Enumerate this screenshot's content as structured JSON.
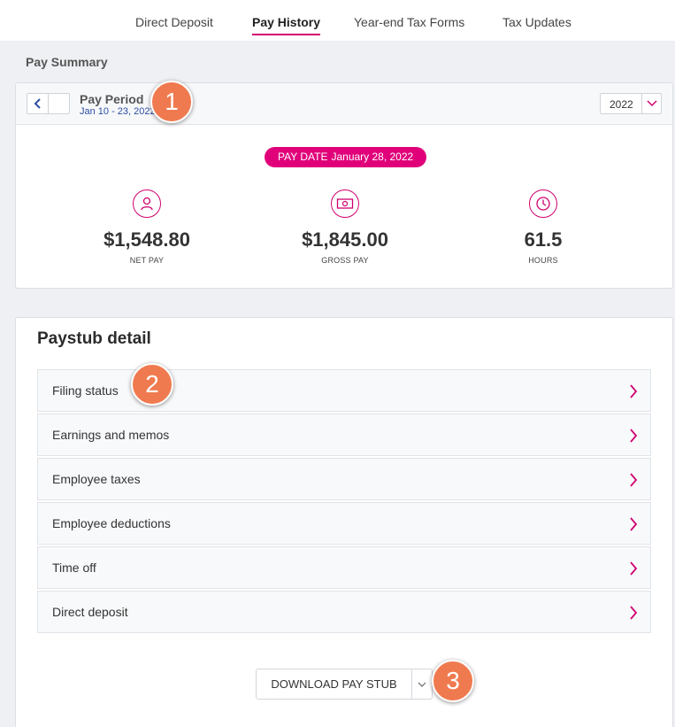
{
  "tabs": [
    {
      "label": "Direct Deposit"
    },
    {
      "label": "Pay History"
    },
    {
      "label": "Year-end Tax Forms"
    },
    {
      "label": "Tax Updates"
    }
  ],
  "section_label": "Pay Summary",
  "period": {
    "title": "Pay Period",
    "range": "Jan 10 - 23, 2022",
    "year": "2022"
  },
  "pay_date": {
    "label": "PAY DATE",
    "value": "January 28, 2022"
  },
  "stats": [
    {
      "value": "$1,548.80",
      "label": "NET PAY",
      "icon": "person-icon"
    },
    {
      "value": "$1,845.00",
      "label": "GROSS PAY",
      "icon": "money-icon"
    },
    {
      "value": "61.5",
      "label": "HOURS",
      "icon": "clock-icon"
    }
  ],
  "detail": {
    "title": "Paystub detail",
    "rows": [
      {
        "label": "Filing status"
      },
      {
        "label": "Earnings and memos"
      },
      {
        "label": "Employee taxes"
      },
      {
        "label": "Employee deductions"
      },
      {
        "label": "Time off"
      },
      {
        "label": "Direct deposit"
      }
    ],
    "download_label": "DOWNLOAD PAY STUB"
  },
  "callouts": [
    "1",
    "2",
    "3"
  ],
  "colors": {
    "accent": "#d0006f",
    "pay_date_bg": "#e0007a",
    "link_blue": "#2c4fa3",
    "callout": "#f07a4f"
  }
}
